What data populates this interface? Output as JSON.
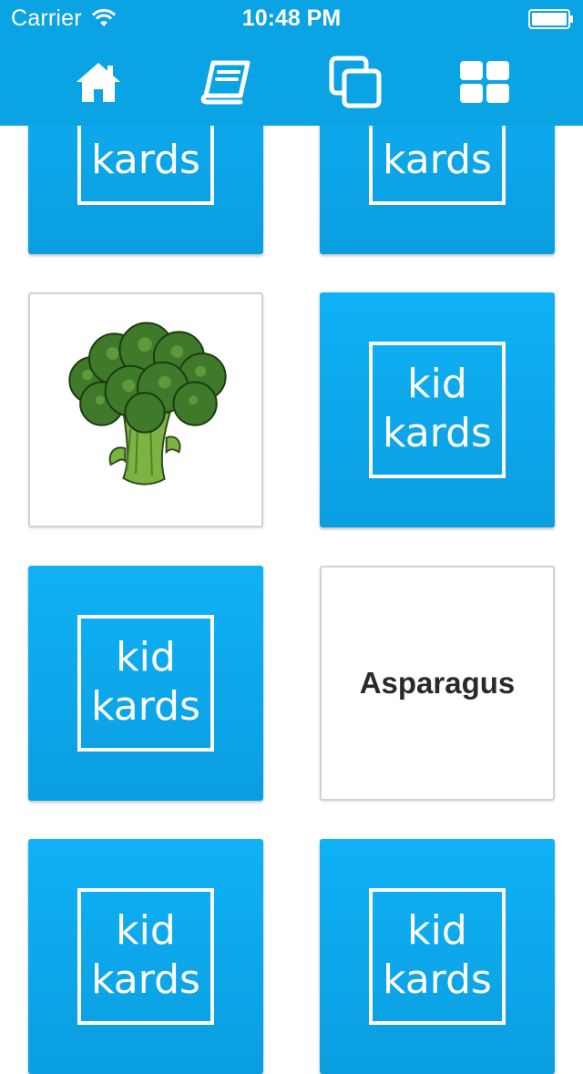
{
  "status_bar": {
    "carrier": "Carrier",
    "time": "10:48 PM"
  },
  "toolbar": {
    "items": [
      {
        "icon": "home-icon"
      },
      {
        "icon": "book-icon"
      },
      {
        "icon": "copy-icon"
      },
      {
        "icon": "grid-icon"
      }
    ]
  },
  "colors": {
    "header": "#0aa3e4",
    "card_back": "#10b1f6",
    "card_border": "#d2d2d2",
    "broccoli_head": "#3f7a2a",
    "broccoli_stem": "#7cb342"
  },
  "logo": {
    "line1": "kid",
    "line2": "kards"
  },
  "cards": [
    {
      "type": "back"
    },
    {
      "type": "back"
    },
    {
      "type": "image",
      "image": "broccoli"
    },
    {
      "type": "back"
    },
    {
      "type": "back"
    },
    {
      "type": "word",
      "word": "Asparagus"
    },
    {
      "type": "back"
    },
    {
      "type": "back"
    }
  ]
}
